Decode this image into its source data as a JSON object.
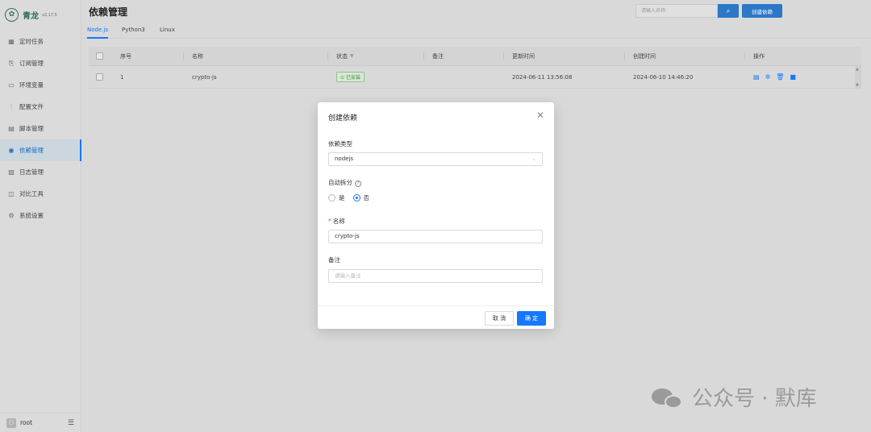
{
  "app": {
    "brand_name": "青龙",
    "version": "v2.17.5",
    "page_title": "依赖管理"
  },
  "sidebar": {
    "items": [
      {
        "label": "定时任务",
        "icon": "calendar-icon"
      },
      {
        "label": "订阅管理",
        "icon": "subscribe-icon"
      },
      {
        "label": "环境变量",
        "icon": "env-icon"
      },
      {
        "label": "配置文件",
        "icon": "sliders-icon"
      },
      {
        "label": "脚本管理",
        "icon": "script-icon"
      },
      {
        "label": "依赖管理",
        "icon": "dependency-icon",
        "active": true
      },
      {
        "label": "日志管理",
        "icon": "log-icon"
      },
      {
        "label": "对比工具",
        "icon": "diff-icon"
      },
      {
        "label": "系统设置",
        "icon": "gear-icon"
      }
    ],
    "user": "root"
  },
  "header": {
    "search_placeholder": "请输入名称",
    "search_icon": "search-icon",
    "create_label": "创建依赖"
  },
  "tabs": [
    "Node.js",
    "Python3",
    "Linux"
  ],
  "table": {
    "columns": [
      "序号",
      "名称",
      "状态",
      "备注",
      "更新时间",
      "创建时间",
      "操作"
    ],
    "rows": [
      {
        "index": "1",
        "name": "crypto-js",
        "status": "已安装",
        "remark": "",
        "updated": "2024-06-11 13:56:08",
        "created": "2024-06-10 14:46:20"
      }
    ],
    "row_actions": [
      "log-icon",
      "debug-icon",
      "delete-icon",
      "trash-icon"
    ]
  },
  "modal": {
    "title": "创建依赖",
    "type_label": "依赖类型",
    "type_value": "nodejs",
    "split_label": "自动拆分",
    "split_options": [
      "是",
      "否"
    ],
    "split_selected": "否",
    "name_label": "名称",
    "name_value": "crypto-js",
    "remark_label": "备注",
    "remark_placeholder": "请输入备注",
    "cancel_label": "取 消",
    "ok_label": "确 定"
  },
  "watermark": {
    "text": "公众号 · 默库"
  },
  "colors": {
    "primary": "#1677ff",
    "brand": "#2f6d4e",
    "success": "#3f8f3f"
  }
}
